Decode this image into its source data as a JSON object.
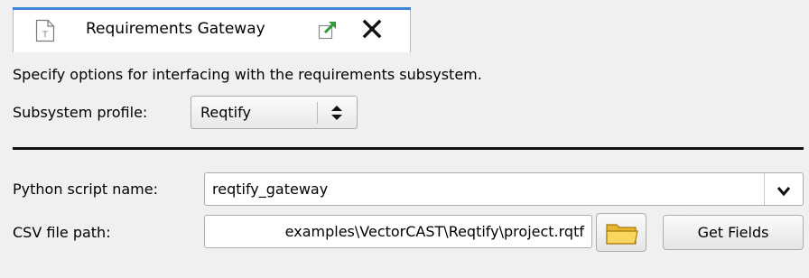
{
  "tab": {
    "title": "Requirements Gateway",
    "doc_icon": "document-icon",
    "undock_icon": "undock-icon",
    "close_icon": "close-icon"
  },
  "panel": {
    "description": "Specify options for interfacing with the requirements subsystem.",
    "subsystem_profile": {
      "label": "Subsystem profile:",
      "value": "Reqtify"
    },
    "python_script": {
      "label": "Python script name:",
      "value": "reqtify_gateway"
    },
    "csv_path": {
      "label": "CSV file path:",
      "value": "examples\\VectorCAST\\Reqtify\\project.rqtf"
    },
    "browse_icon": "folder-icon",
    "get_fields_label": "Get Fields"
  },
  "colors": {
    "accent": "#3b86d6",
    "background": "#f0f0f0",
    "folder": "#f5c542"
  }
}
